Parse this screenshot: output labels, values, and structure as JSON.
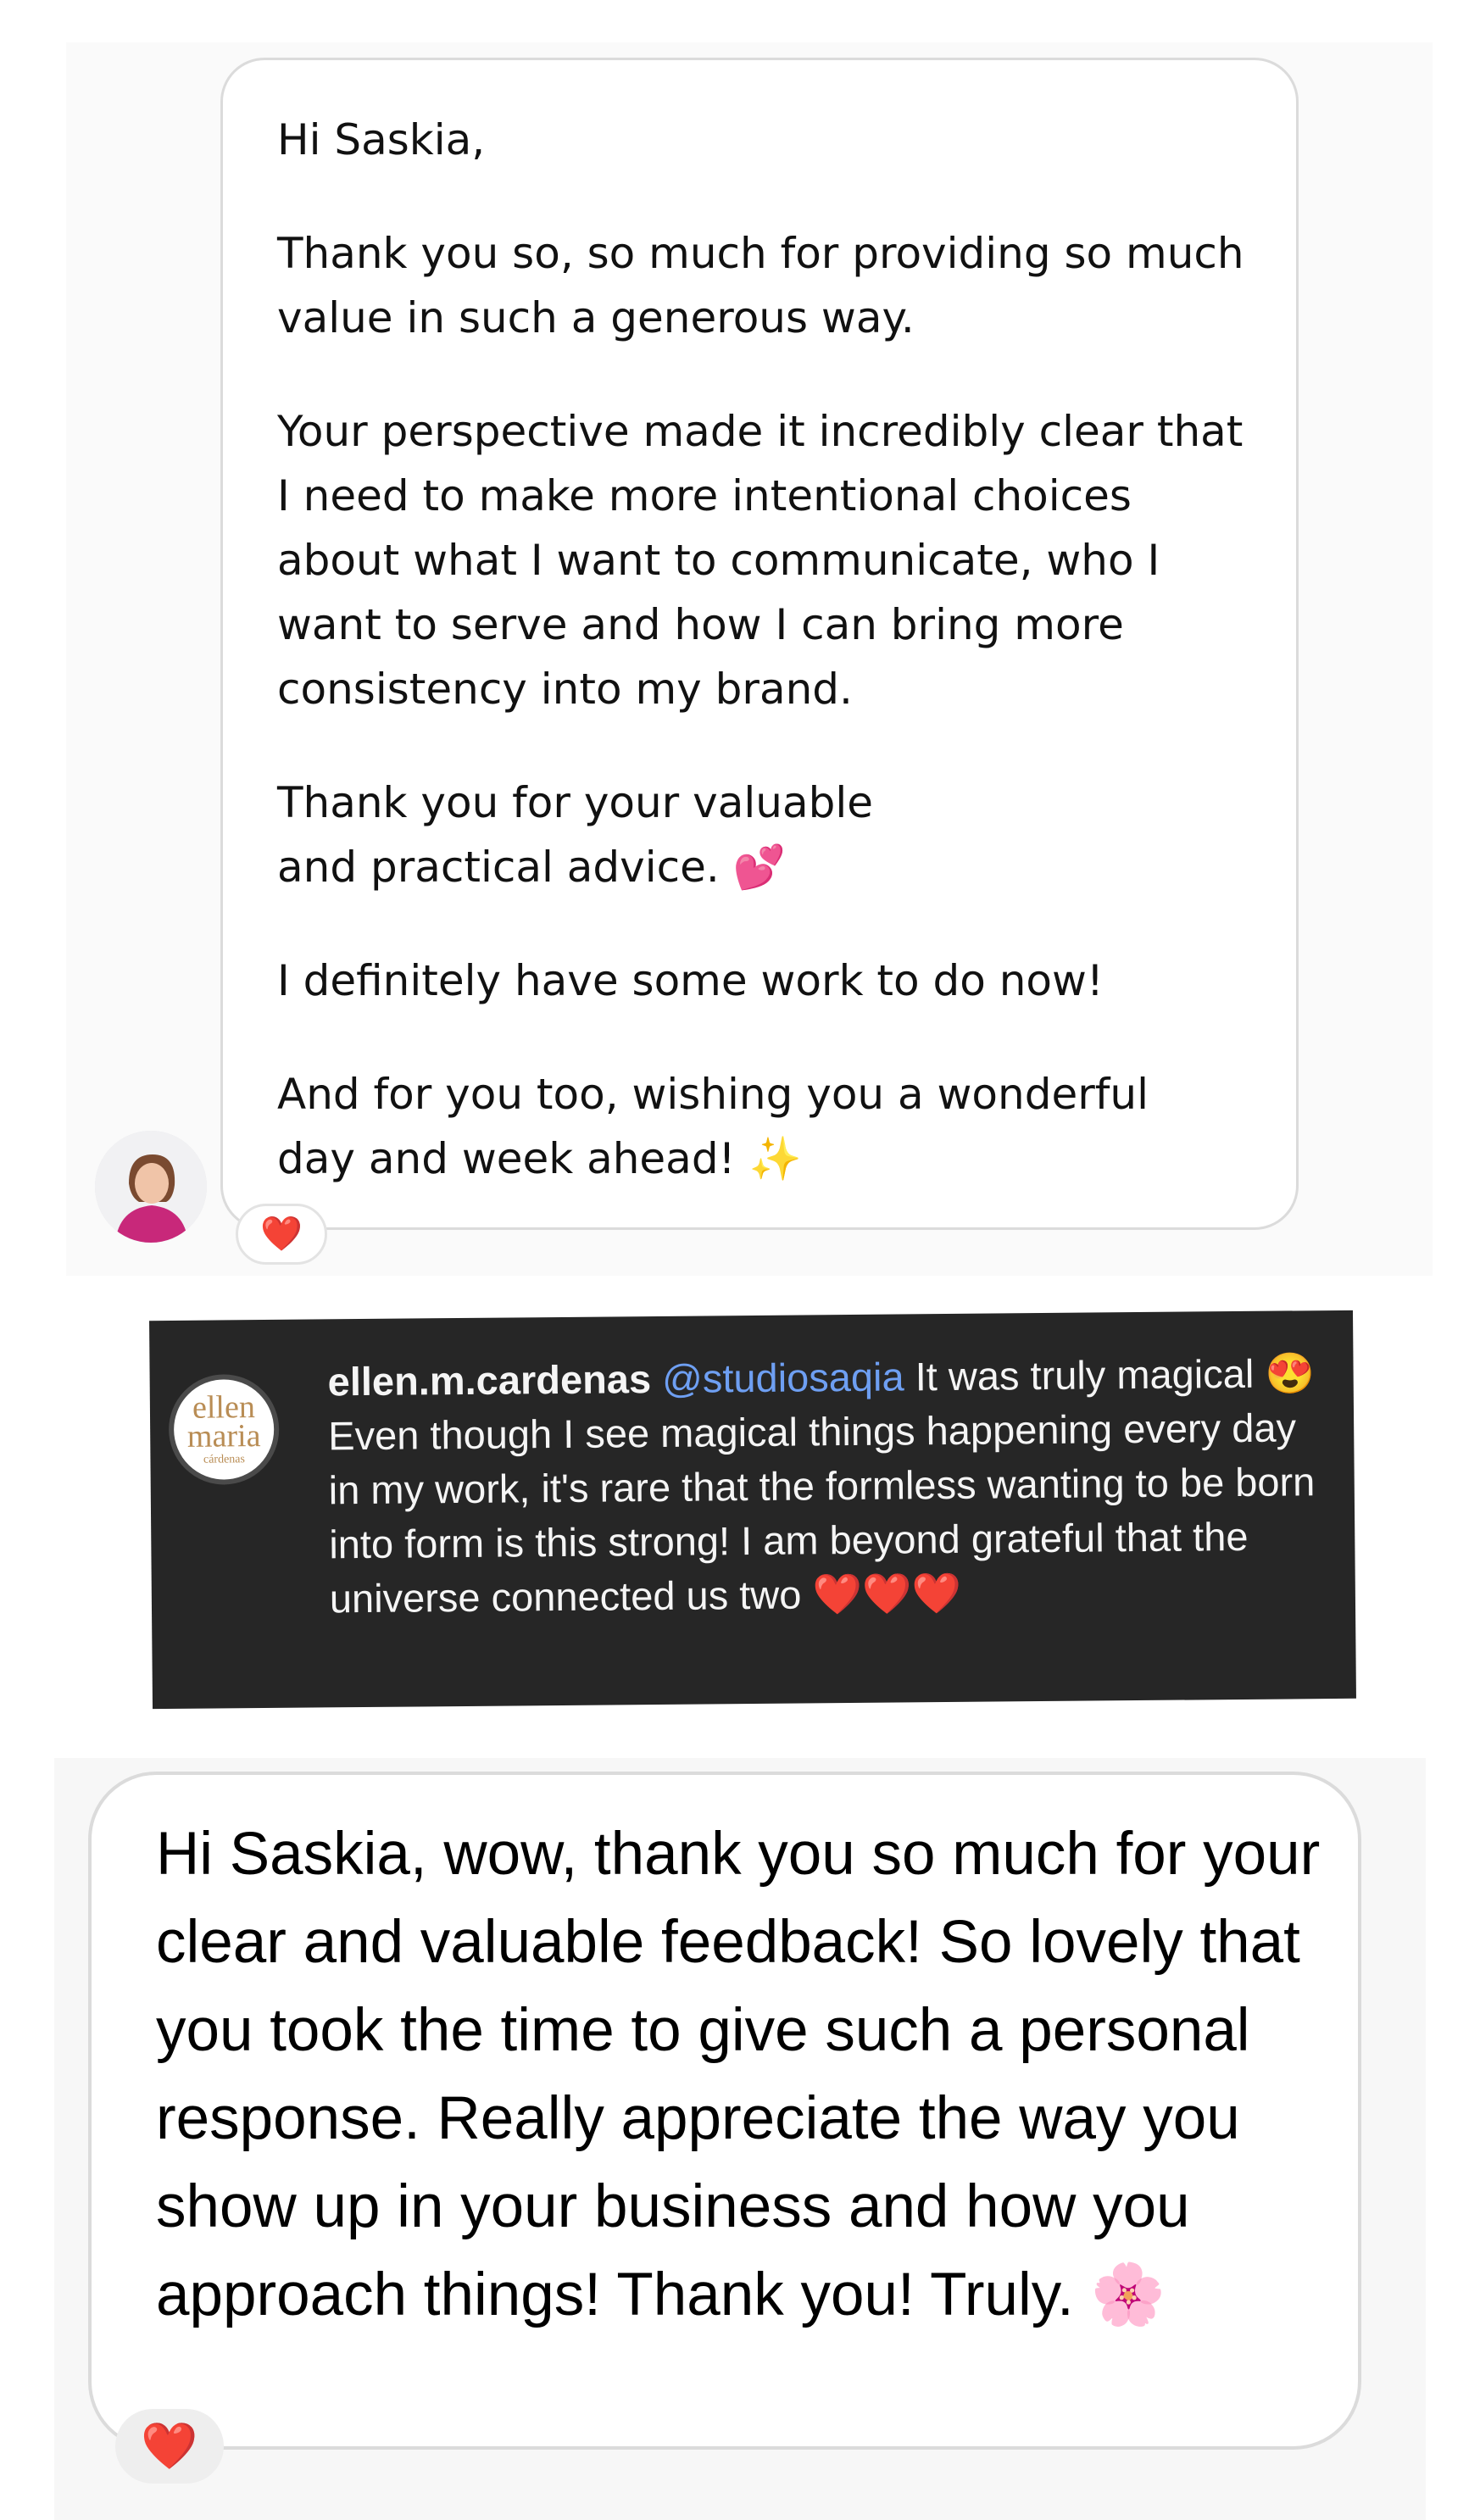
{
  "dm_top": {
    "greeting": "Hi Saskia,",
    "paragraphs": [
      "Thank you so, so much for providing so much value in such a generous way.",
      "Your perspective made it incredibly clear that I need to make more intentional choices about what I want to communicate, who I want to serve and how I can bring more consistency into my brand.",
      "Thank you for your valuable and practical advice. 💕",
      "I definitely have some work to do now!",
      "And for you too, wishing you a wonderful day and week ahead! ✨"
    ],
    "reaction": "❤️",
    "avatar_icon": "user-avatar-photo"
  },
  "comment": {
    "logo_lines": [
      "ellen",
      "maria",
      "cárdenas"
    ],
    "username": "ellen.m.cardenas",
    "mention": "@studiosaqia",
    "text": "It was truly magical 😍 Even though I see magical things happening every day in my work, it's rare that the formless wanting to be born into form is this strong! I am beyond grateful that the universe connected us two ❤️❤️❤️",
    "mention_color": "#6e9ff2"
  },
  "dm_bottom": {
    "message": "Hi Saskia, wow, thank you so much for your clear and valuable feedback! So lovely that you took the time to give such a personal response. Really appreciate the way you show up in your business and how you approach things! Thank you! Truly. 🌸",
    "reaction": "❤️"
  },
  "colors": {
    "heart": "#e0245e",
    "bubble_border": "#dbdbdb",
    "comment_bg": "#262626"
  }
}
